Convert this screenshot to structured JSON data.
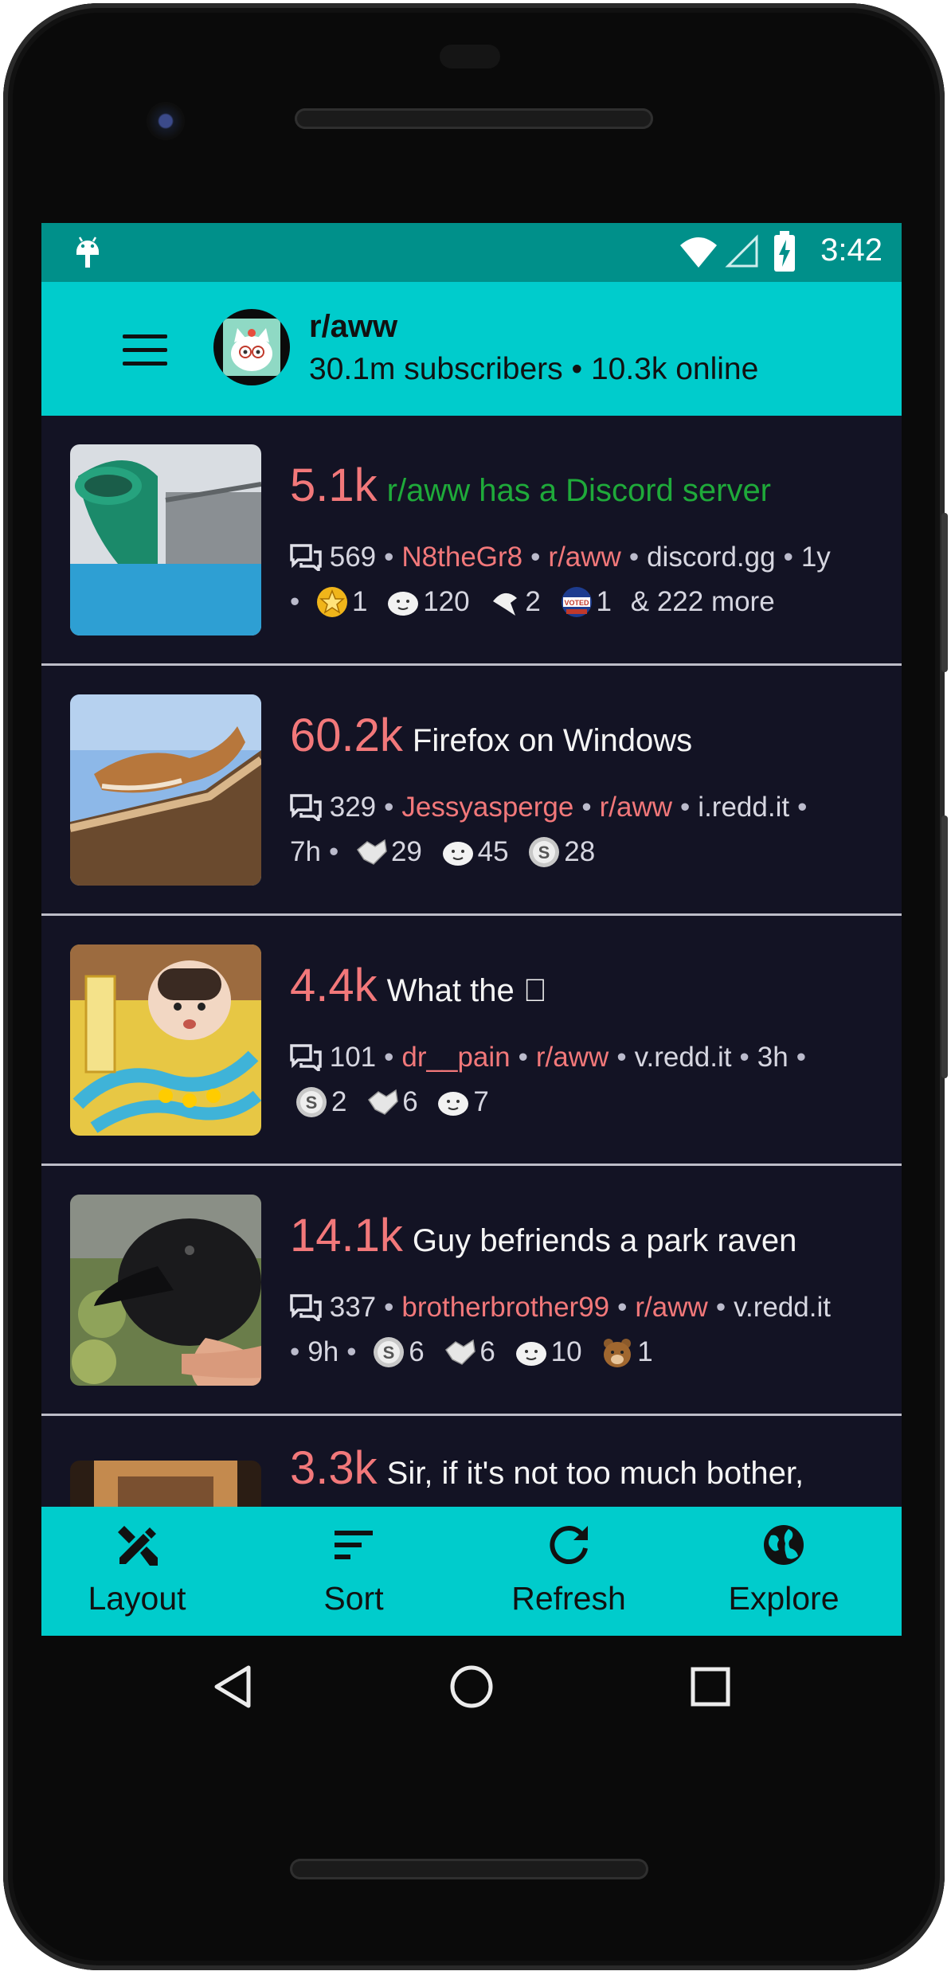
{
  "status_bar": {
    "time": "3:42"
  },
  "toolbar": {
    "title": "r/aww",
    "subtitle": "30.1m subscribers • 10.3k online"
  },
  "posts": [
    {
      "score": "5.1k",
      "title": "r/aww has a Discord server",
      "comments": "569",
      "author": "N8theGr8",
      "subreddit": "r/aww",
      "domain": "discord.gg",
      "age": "1y",
      "awards": [
        {
          "icon": "gold-star-award-icon",
          "count": "1"
        },
        {
          "icon": "wholesome-seal-award-icon",
          "count": "120"
        },
        {
          "icon": "helpful-hand-award-icon",
          "count": "2"
        },
        {
          "icon": "voted-award-icon",
          "count": "1"
        }
      ],
      "more_awards": "& 222 more"
    },
    {
      "score": "60.2k",
      "title": "Firefox on Windows",
      "comments": "329",
      "author": "Jessyasperge",
      "subreddit": "r/aww",
      "domain": "i.redd.it",
      "age": "7h",
      "awards": [
        {
          "icon": "handshake-award-icon",
          "count": "29"
        },
        {
          "icon": "wholesome-seal-award-icon",
          "count": "45"
        },
        {
          "icon": "silver-award-icon",
          "count": "28"
        }
      ]
    },
    {
      "score": "4.4k",
      "title": "What the \u0000",
      "comments": "101",
      "author": "dr__pain",
      "subreddit": "r/aww",
      "domain": "v.redd.it",
      "age": "3h",
      "awards": [
        {
          "icon": "silver-award-icon",
          "count": "2"
        },
        {
          "icon": "handshake-award-icon",
          "count": "6"
        },
        {
          "icon": "wholesome-seal-award-icon",
          "count": "7"
        }
      ]
    },
    {
      "score": "14.1k",
      "title": "Guy befriends a park raven",
      "comments": "337",
      "author": "brotherbrother99",
      "subreddit": "r/aww",
      "domain": "v.redd.it",
      "age": "9h",
      "awards": [
        {
          "icon": "silver-award-icon",
          "count": "6"
        },
        {
          "icon": "handshake-award-icon",
          "count": "6"
        },
        {
          "icon": "wholesome-seal-award-icon",
          "count": "10"
        },
        {
          "icon": "bear-award-icon",
          "count": "1"
        }
      ]
    },
    {
      "score": "3.3k",
      "title": "Sir, if it's not too much bother,"
    }
  ],
  "bottom_bar": {
    "layout": "Layout",
    "sort": "Sort",
    "refresh": "Refresh",
    "explore": "Explore"
  },
  "colors": {
    "accent": "#00cccc",
    "status_bar": "#00908a",
    "background": "#131324",
    "score": "#f2787a",
    "sticky_title": "#1faa3a"
  }
}
